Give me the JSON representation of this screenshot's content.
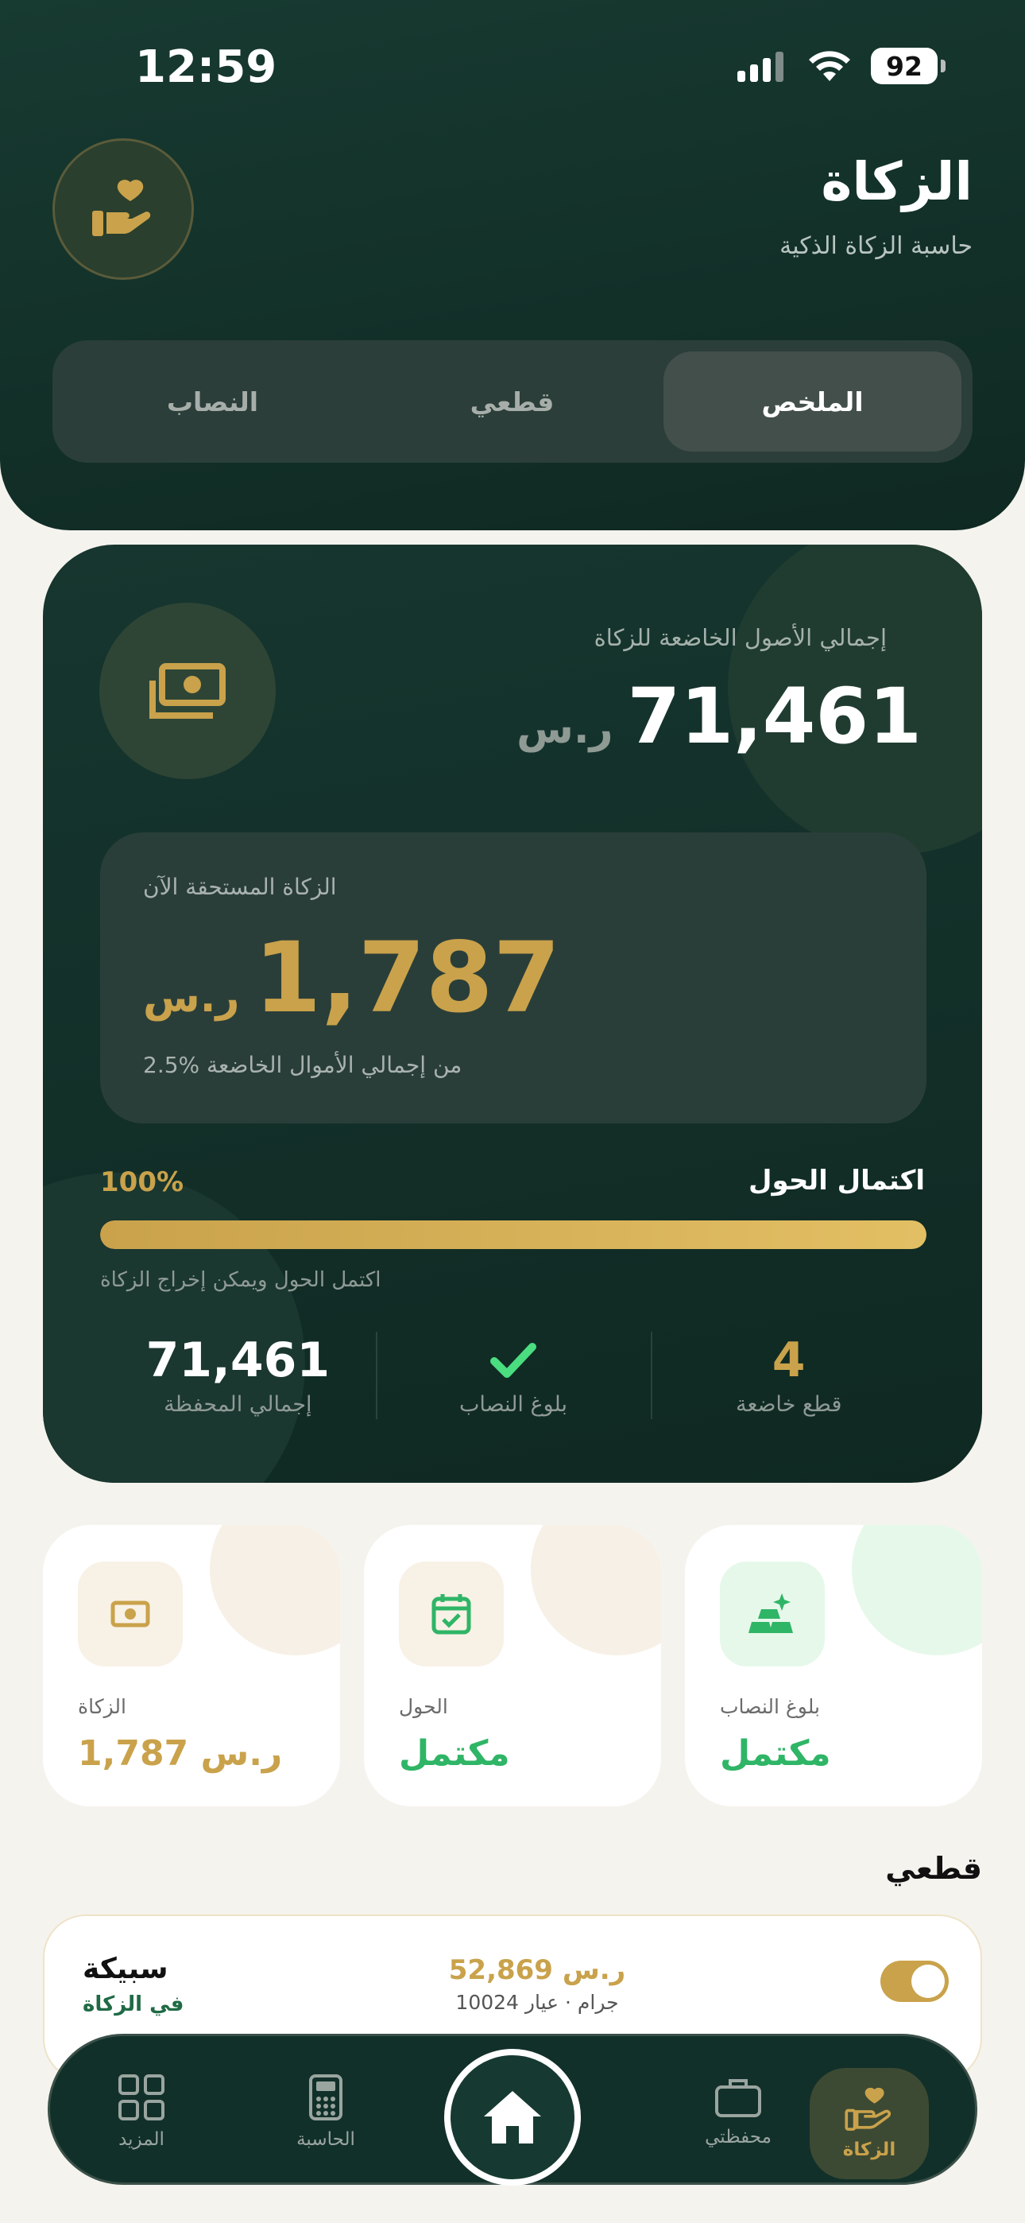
{
  "status": {
    "time": "12:59",
    "battery": "92"
  },
  "header": {
    "title": "الزكاة",
    "subtitle": "حاسبة الزكاة الذكية"
  },
  "tabs": [
    {
      "label": "الملخص",
      "active": true
    },
    {
      "label": "قطعي",
      "active": false
    },
    {
      "label": "النصاب",
      "active": false
    }
  ],
  "summary": {
    "assets_label": "إجمالي الأصول الخاضعة للزكاة",
    "assets_amount": "71,461",
    "currency": "ر.س",
    "due_label": "الزكاة المستحقة الآن",
    "due_amount": "1,787",
    "due_note": "2.5% من إجمالي الأموال الخاضعة",
    "hawl_title": "اكتمال الحول",
    "hawl_percent": "100%",
    "hawl_progress": 1.0,
    "hawl_note": "اكتمل الحول ويمكن إخراج الزكاة"
  },
  "stats": [
    {
      "value": "4",
      "label": "قطع خاضعة",
      "color": "#c9a24b"
    },
    {
      "value": "",
      "label": "بلوغ النصاب",
      "icon": "check-icon",
      "color": "#4ade80"
    },
    {
      "value": "71,461",
      "label": "إجمالي المحفظة",
      "color": "#ffffff"
    }
  ],
  "mini_cards": [
    {
      "label": "الزكاة",
      "value": "1,787 ر.س",
      "icon": "cash-icon",
      "color": "#c9a24b"
    },
    {
      "label": "الحول",
      "value": "مكتمل",
      "icon": "calendar-check-icon",
      "color": "#2fb566"
    },
    {
      "label": "بلوغ النصاب",
      "value": "مكتمل",
      "icon": "gold-bars-icon",
      "color": "#2fb566"
    }
  ],
  "section_title": "قطعي",
  "asset": {
    "name": "سبيكة",
    "sub": "في الزكاة",
    "value": "52,869 ر.س",
    "meta": "100جرام · عيار 24",
    "enabled": true
  },
  "nav": [
    {
      "label": "المزيد",
      "icon": "grid-icon"
    },
    {
      "label": "الحاسبة",
      "icon": "calculator-icon"
    },
    {
      "label": "",
      "icon": "home-icon"
    },
    {
      "label": "محفظتي",
      "icon": "briefcase-icon"
    },
    {
      "label": "الزكاة",
      "icon": "zakat-hand-icon",
      "active": true
    }
  ]
}
